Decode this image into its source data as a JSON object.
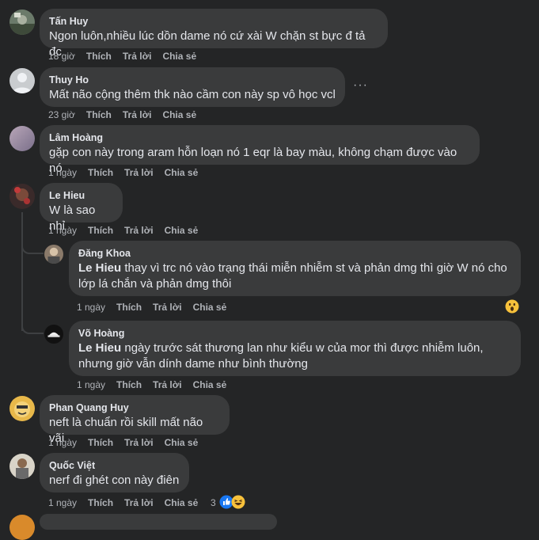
{
  "comments": [
    {
      "name": "Tấn Huy",
      "text": "Ngon luôn,nhiều lúc dồn dame nó cứ xài W chặn st bực đ tả đc",
      "time": "18 giờ"
    },
    {
      "name": "Thuy Ho",
      "text": "Mất não cộng thêm thk nào cầm con này sp vô học vcl",
      "time": "23 giờ"
    },
    {
      "name": "Lâm Hoàng",
      "text": "gặp con này trong aram hỗn loạn nó 1 eqr là bay màu, không chạm được vào nó",
      "time": "1 ngày"
    },
    {
      "name": "Le Hieu",
      "text": "W là sao nhỉ",
      "time": "1 ngày"
    },
    {
      "name": "Phan Quang Huy",
      "text": "neft là chuẩn rồi skill mất não vãi",
      "time": "1 ngày"
    },
    {
      "name": "Quốc Việt",
      "text": "nerf đi ghét con này điên",
      "time": "1 ngày",
      "reaction_count": "3"
    }
  ],
  "replies": [
    {
      "name": "Đăng Khoa",
      "mention": "Le Hieu",
      "text_line1": " thay vì trc nó vào trạng thái miễn nhiễm st và phản dmg thì giờ W nó cho",
      "text_line2": "lớp lá chắn và phản dmg thôi",
      "time": "1 ngày"
    },
    {
      "name": "Võ Hoàng",
      "mention": "Le Hieu",
      "text_line1": " ngày trước sát thương lan như kiểu w của mor thì được nhiễm luôn,",
      "text_line2": "nhưng giờ vẫn dính dame như bình thường",
      "time": "1 ngày"
    }
  ],
  "actions": {
    "like": "Thích",
    "reply": "Trả lời",
    "share": "Chia sẻ"
  },
  "more_label": "···",
  "colors": {
    "background": "#242526",
    "bubble": "#3a3b3c",
    "text": "#e4e6eb",
    "muted": "#b0b3b8"
  }
}
